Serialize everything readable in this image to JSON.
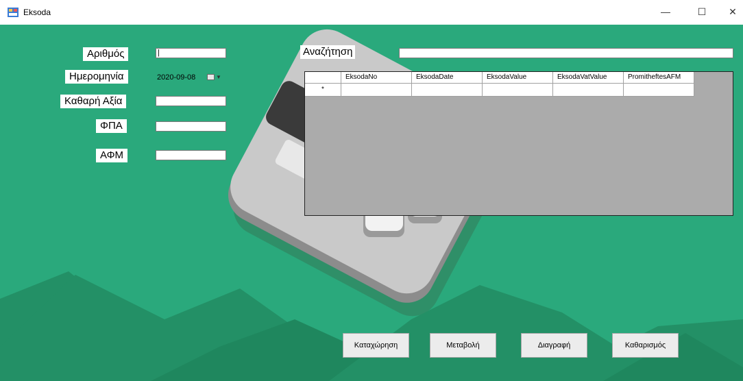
{
  "window": {
    "title": "Eksoda",
    "controls": {
      "minimize": "—",
      "maximize": "☐",
      "close": "✕"
    }
  },
  "form": {
    "arithmos_label": "Αριθμός",
    "arithmos_value": "|",
    "date_label": "Ημερομηνία",
    "date_value": "2020-09-08",
    "net_label": "Καθαρή Αξία",
    "net_value": "",
    "vat_label": "ΦΠΑ",
    "vat_value": "",
    "afm_label": "ΑΦΜ",
    "afm_value": ""
  },
  "search": {
    "label": "Αναζήτηση",
    "value": ""
  },
  "grid": {
    "columns": [
      "EksodaNo",
      "EksodaDate",
      "EksodaValue",
      "EksodaVatValue",
      "PromitheftesAFM"
    ],
    "new_row_marker": "*"
  },
  "buttons": {
    "insert": "Καταχώρηση",
    "update": "Μεταβολή",
    "delete": "Διαγραφή",
    "clear": "Καθαρισμός"
  },
  "colors": {
    "background": "#2aa97c",
    "mountains": "#239066",
    "grid_bg": "#ababab"
  }
}
